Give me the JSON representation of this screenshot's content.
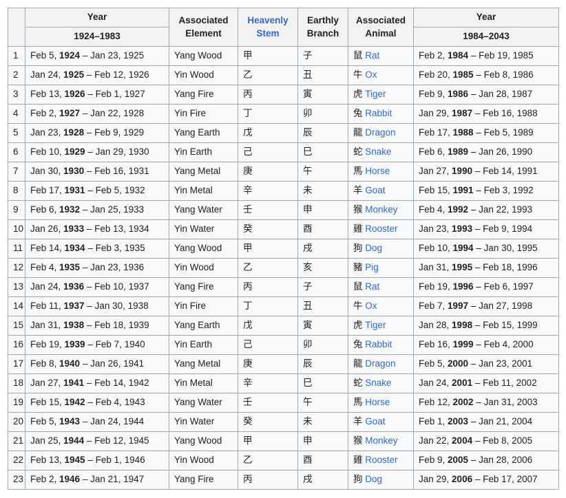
{
  "table": {
    "headers": {
      "index": "",
      "year_left_top": "Year",
      "year_left_range": "1924–1983",
      "element": "Associated Element",
      "element_line1": "Associated",
      "element_line2": "Element",
      "stem": "Heavenly Stem",
      "stem_line1": "Heavenly",
      "stem_line2": "Stem",
      "branch": "Earthly Branch",
      "branch_line1": "Earthly",
      "branch_line2": "Branch",
      "animal": "Associated Animal",
      "animal_line1": "Associated",
      "animal_line2": "Animal",
      "year_right_top": "Year",
      "year_right_range": "1984–2043"
    },
    "link_color": "#3366cc",
    "border_color": "#a2a9b1",
    "header_bg": "#f2f2f2",
    "cell_bg": "#f8f9fa",
    "rows": [
      {
        "n": "1",
        "y1": "Feb  5, 1924 – Jan 23, 1925",
        "y1a": "Feb  5, ",
        "y1b": "1924",
        "y1c": " – Jan 23, 1925",
        "elem": "Yang Wood",
        "stem": "甲",
        "branch": "子",
        "animal_cjk": "鼠",
        "animal": "Rat",
        "y2a": "Feb  2, ",
        "y2b": "1984",
        "y2c": " – Feb 19, 1985"
      },
      {
        "n": "2",
        "y1": "Jan 24, 1925 – Feb 12, 1926",
        "y1a": "Jan 24, ",
        "y1b": "1925",
        "y1c": " – Feb 12, 1926",
        "elem": "Yin Wood",
        "stem": "乙",
        "branch": "丑",
        "animal_cjk": "牛",
        "animal": "Ox",
        "y2a": "Feb 20, ",
        "y2b": "1985",
        "y2c": " – Feb  8, 1986"
      },
      {
        "n": "3",
        "y1": "Feb 13, 1926 – Feb  1, 1927",
        "y1a": "Feb 13, ",
        "y1b": "1926",
        "y1c": " – Feb  1, 1927",
        "elem": "Yang Fire",
        "stem": "丙",
        "branch": "寅",
        "animal_cjk": "虎",
        "animal": "Tiger",
        "y2a": "Feb  9, ",
        "y2b": "1986",
        "y2c": " – Jan 28, 1987"
      },
      {
        "n": "4",
        "y1": "Feb  2, 1927 – Jan 22, 1928",
        "y1a": "Feb  2, ",
        "y1b": "1927",
        "y1c": " – Jan 22, 1928",
        "elem": "Yin Fire",
        "stem": "丁",
        "branch": "卯",
        "animal_cjk": "兔",
        "animal": "Rabbit",
        "y2a": "Jan 29, ",
        "y2b": "1987",
        "y2c": " – Feb 16, 1988"
      },
      {
        "n": "5",
        "y1": "Jan 23, 1928 – Feb  9, 1929",
        "y1a": "Jan 23, ",
        "y1b": "1928",
        "y1c": " – Feb  9, 1929",
        "elem": "Yang Earth",
        "stem": "戊",
        "branch": "辰",
        "animal_cjk": "龍",
        "animal": "Dragon",
        "y2a": "Feb 17, ",
        "y2b": "1988",
        "y2c": " – Feb  5, 1989"
      },
      {
        "n": "6",
        "y1": "Feb 10, 1929 – Jan 29, 1930",
        "y1a": "Feb 10, ",
        "y1b": "1929",
        "y1c": " – Jan 29, 1930",
        "elem": "Yin Earth",
        "stem": "己",
        "branch": "巳",
        "animal_cjk": "蛇",
        "animal": "Snake",
        "y2a": "Feb  6, ",
        "y2b": "1989",
        "y2c": " – Jan 26, 1990"
      },
      {
        "n": "7",
        "y1": "Jan 30, 1930 – Feb 16, 1931",
        "y1a": "Jan 30, ",
        "y1b": "1930",
        "y1c": " – Feb 16, 1931",
        "elem": "Yang Metal",
        "stem": "庚",
        "branch": "午",
        "animal_cjk": "馬",
        "animal": "Horse",
        "y2a": "Jan 27, ",
        "y2b": "1990",
        "y2c": " – Feb 14, 1991"
      },
      {
        "n": "8",
        "y1": "Feb 17, 1931 – Feb  5, 1932",
        "y1a": "Feb 17, ",
        "y1b": "1931",
        "y1c": " – Feb  5, 1932",
        "elem": "Yin Metal",
        "stem": "辛",
        "branch": "未",
        "animal_cjk": "羊",
        "animal": "Goat",
        "y2a": "Feb 15, ",
        "y2b": "1991",
        "y2c": " – Feb  3, 1992"
      },
      {
        "n": "9",
        "y1": "Feb  6, 1932 – Jan 25, 1933",
        "y1a": "Feb  6, ",
        "y1b": "1932",
        "y1c": " – Jan 25, 1933",
        "elem": "Yang Water",
        "stem": "壬",
        "branch": "申",
        "animal_cjk": "猴",
        "animal": "Monkey",
        "y2a": "Feb  4, ",
        "y2b": "1992",
        "y2c": " – Jan 22, 1993"
      },
      {
        "n": "10",
        "y1": "Jan 26, 1933 – Feb 13, 1934",
        "y1a": "Jan 26, ",
        "y1b": "1933",
        "y1c": " – Feb 13, 1934",
        "elem": "Yin Water",
        "stem": "癸",
        "branch": "酉",
        "animal_cjk": "雞",
        "animal": "Rooster",
        "y2a": "Jan 23, ",
        "y2b": "1993",
        "y2c": " – Feb  9, 1994"
      },
      {
        "n": "11",
        "y1": "Feb 14, 1934 – Feb  3, 1935",
        "y1a": "Feb 14, ",
        "y1b": "1934",
        "y1c": " – Feb  3, 1935",
        "elem": "Yang Wood",
        "stem": "甲",
        "branch": "戌",
        "animal_cjk": "狗",
        "animal": "Dog",
        "y2a": "Feb 10, ",
        "y2b": "1994",
        "y2c": " – Jan 30, 1995"
      },
      {
        "n": "12",
        "y1": "Feb  4, 1935 – Jan 23, 1936",
        "y1a": "Feb  4, ",
        "y1b": "1935",
        "y1c": " – Jan 23, 1936",
        "elem": "Yin Wood",
        "stem": "乙",
        "branch": "亥",
        "animal_cjk": "豬",
        "animal": "Pig",
        "y2a": "Jan 31, ",
        "y2b": "1995",
        "y2c": " – Feb 18, 1996"
      },
      {
        "n": "13",
        "y1": "Jan 24, 1936 – Feb 10, 1937",
        "y1a": "Jan 24, ",
        "y1b": "1936",
        "y1c": " – Feb 10, 1937",
        "elem": "Yang Fire",
        "stem": "丙",
        "branch": "子",
        "animal_cjk": "鼠",
        "animal": "Rat",
        "y2a": "Feb 19, ",
        "y2b": "1996",
        "y2c": " – Feb  6, 1997"
      },
      {
        "n": "14",
        "y1": "Feb 11, 1937 – Jan 30, 1938",
        "y1a": "Feb 11, ",
        "y1b": "1937",
        "y1c": " – Jan 30, 1938",
        "elem": "Yin Fire",
        "stem": "丁",
        "branch": "丑",
        "animal_cjk": "牛",
        "animal": "Ox",
        "y2a": "Feb  7, ",
        "y2b": "1997",
        "y2c": " – Jan 27, 1998"
      },
      {
        "n": "15",
        "y1": "Jan 31, 1938 – Feb 18, 1939",
        "y1a": "Jan 31, ",
        "y1b": "1938",
        "y1c": " – Feb 18, 1939",
        "elem": "Yang Earth",
        "stem": "戊",
        "branch": "寅",
        "animal_cjk": "虎",
        "animal": "Tiger",
        "y2a": "Jan 28, ",
        "y2b": "1998",
        "y2c": " – Feb 15, 1999"
      },
      {
        "n": "16",
        "y1": "Feb 19, 1939 – Feb  7, 1940",
        "y1a": "Feb 19, ",
        "y1b": "1939",
        "y1c": " – Feb  7, 1940",
        "elem": "Yin Earth",
        "stem": "己",
        "branch": "卯",
        "animal_cjk": "兔",
        "animal": "Rabbit",
        "y2a": "Feb 16, ",
        "y2b": "1999",
        "y2c": " – Feb  4, 2000"
      },
      {
        "n": "17",
        "y1": "Feb  8, 1940 – Jan 26, 1941",
        "y1a": "Feb  8, ",
        "y1b": "1940",
        "y1c": " – Jan 26, 1941",
        "elem": "Yang Metal",
        "stem": "庚",
        "branch": "辰",
        "animal_cjk": "龍",
        "animal": "Dragon",
        "y2a": "Feb  5, ",
        "y2b": "2000",
        "y2c": " – Jan 23, 2001"
      },
      {
        "n": "18",
        "y1": "Jan 27, 1941 – Feb 14, 1942",
        "y1a": "Jan 27, ",
        "y1b": "1941",
        "y1c": " – Feb 14, 1942",
        "elem": "Yin Metal",
        "stem": "辛",
        "branch": "巳",
        "animal_cjk": "蛇",
        "animal": "Snake",
        "y2a": "Jan 24, ",
        "y2b": "2001",
        "y2c": " – Feb 11, 2002"
      },
      {
        "n": "19",
        "y1": "Feb 15, 1942 – Feb  4, 1943",
        "y1a": "Feb 15, ",
        "y1b": "1942",
        "y1c": " – Feb  4, 1943",
        "elem": "Yang Water",
        "stem": "壬",
        "branch": "午",
        "animal_cjk": "馬",
        "animal": "Horse",
        "y2a": "Feb 12, ",
        "y2b": "2002",
        "y2c": " – Jan 31, 2003"
      },
      {
        "n": "20",
        "y1": "Feb  5, 1943 – Jan 24, 1944",
        "y1a": "Feb  5, ",
        "y1b": "1943",
        "y1c": " – Jan 24, 1944",
        "elem": "Yin Water",
        "stem": "癸",
        "branch": "未",
        "animal_cjk": "羊",
        "animal": "Goat",
        "y2a": "Feb  1, ",
        "y2b": "2003",
        "y2c": " – Jan 21, 2004"
      },
      {
        "n": "21",
        "y1": "Jan 25, 1944 – Feb 12, 1945",
        "y1a": "Jan 25, ",
        "y1b": "1944",
        "y1c": " – Feb 12, 1945",
        "elem": "Yang Wood",
        "stem": "甲",
        "branch": "申",
        "animal_cjk": "猴",
        "animal": "Monkey",
        "y2a": "Jan 22, ",
        "y2b": "2004",
        "y2c": " – Feb  8, 2005"
      },
      {
        "n": "22",
        "y1": "Feb 13, 1945 – Feb  1, 1946",
        "y1a": "Feb 13, ",
        "y1b": "1945",
        "y1c": " – Feb  1, 1946",
        "elem": "Yin Wood",
        "stem": "乙",
        "branch": "酉",
        "animal_cjk": "雞",
        "animal": "Rooster",
        "y2a": "Feb  9, ",
        "y2b": "2005",
        "y2c": " – Jan 28, 2006"
      },
      {
        "n": "23",
        "y1": "Feb  2, 1946 – Jan 21, 1947",
        "y1a": "Feb  2, ",
        "y1b": "1946",
        "y1c": " – Jan 21, 1947",
        "elem": "Yang Fire",
        "stem": "丙",
        "branch": "戌",
        "animal_cjk": "狗",
        "animal": "Dog",
        "y2a": "Jan 29, ",
        "y2b": "2006",
        "y2c": " – Feb 17, 2007"
      }
    ]
  }
}
